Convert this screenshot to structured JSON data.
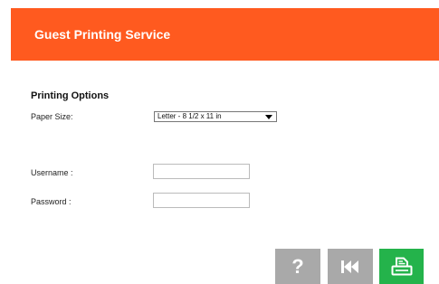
{
  "header": {
    "title": "Guest Printing Service"
  },
  "printing_options": {
    "section_title": "Printing Options",
    "paper_size_label": "Paper Size:",
    "paper_size_selected": "Letter - 8 1/2 x 11 in"
  },
  "credentials": {
    "username_label": "Username :",
    "username_value": "",
    "password_label": "Password :",
    "password_value": ""
  },
  "buttons": {
    "help_label": "?",
    "help_icon": "question-mark-icon",
    "back_icon": "skip-back-icon",
    "print_icon": "printer-icon"
  },
  "colors": {
    "header_bg": "#ff5a1f",
    "gray_button": "#a9a9a9",
    "print_button": "#24b34b"
  }
}
